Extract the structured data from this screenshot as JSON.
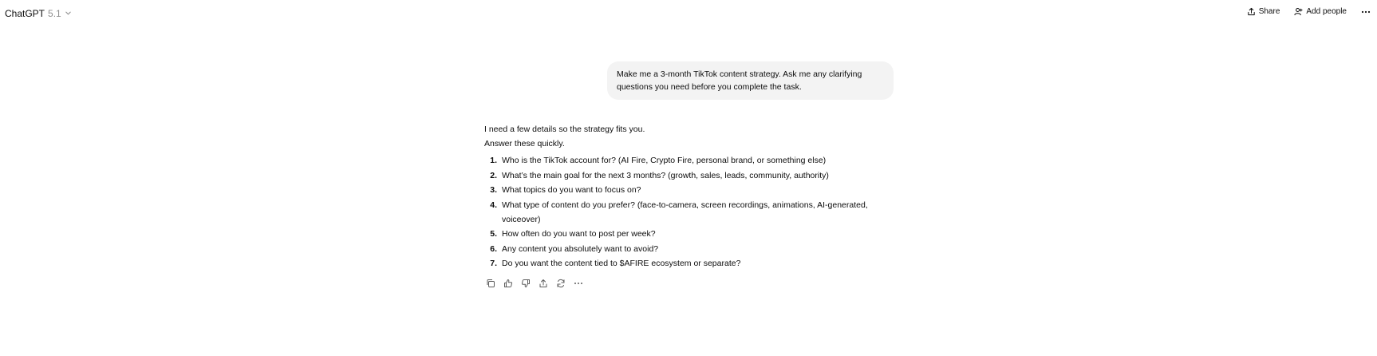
{
  "header": {
    "model_name": "ChatGPT",
    "model_version": "5.1",
    "share_label": "Share",
    "add_people_label": "Add people"
  },
  "user_message": {
    "text": "Make me a 3-month TikTok content strategy. Ask me any clarifying questions you need before you complete the task."
  },
  "assistant_message": {
    "intro_line1": "I need a few details so the strategy fits you.",
    "intro_line2": "Answer these quickly.",
    "questions": [
      {
        "num": "1.",
        "text": "Who is the TikTok account for? (AI Fire, Crypto Fire, personal brand, or something else)"
      },
      {
        "num": "2.",
        "text": "What’s the main goal for the next 3 months? (growth, sales, leads, community, authority)"
      },
      {
        "num": "3.",
        "text": "What topics do you want to focus on?"
      },
      {
        "num": "4.",
        "text": "What type of content do you prefer? (face-to-camera, screen recordings, animations, AI-generated, voiceover)"
      },
      {
        "num": "5.",
        "text": "How often do you want to post per week?"
      },
      {
        "num": "6.",
        "text": "Any content you absolutely want to avoid?"
      },
      {
        "num": "7.",
        "text": "Do you want the content tied to $AFIRE ecosystem or separate?"
      }
    ]
  },
  "message_actions": [
    "copy-icon",
    "thumbs-up-icon",
    "thumbs-down-icon",
    "share-icon",
    "regenerate-icon",
    "more-icon"
  ]
}
